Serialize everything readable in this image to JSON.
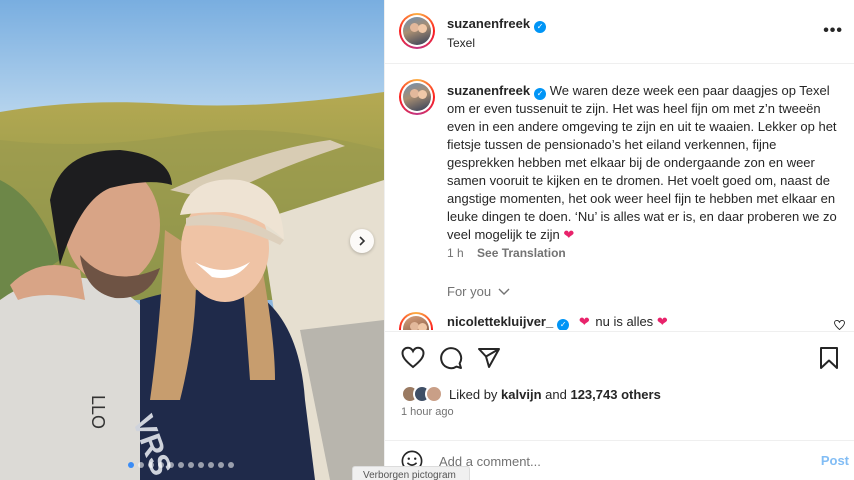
{
  "post": {
    "username": "suzanenfreek",
    "location": "Texel",
    "more_label": "•••",
    "caption": "We waren deze week een paar daagjes op Texel om er even tussenuit te zijn. Het was heel fijn om met z’n tweeën even in een andere omgeving te zijn en uit te waaien. Lekker op het fietsje tussen de pensionado’s het eiland verkennen, fijne gesprekken hebben met elkaar bij de ondergaande zon en weer samen vooruit te kijken en te dromen. Het voelt goed om, naast de angstige momenten, het ook weer heel fijn te hebben met elkaar en leuke dingen te doen. ‘Nu’ is alles wat er is, en daar proberen we zo veel mogelijk te zijn",
    "caption_emoji": "❤",
    "age": "1 h",
    "see_translation": "See Translation",
    "for_you": "For you"
  },
  "comment": {
    "username": "nicolettekluijver_",
    "emoji": "❤",
    "text": "nu is alles",
    "like_icon": "heart-outline-icon"
  },
  "likes": {
    "prefix": "Liked by",
    "user": "kalvijn",
    "and": "and",
    "count": "123,743 others"
  },
  "timestamp": "1 hour ago",
  "add_comment": {
    "placeholder": "Add a comment...",
    "post_label": "Post"
  },
  "tooltip": "Verborgen pictogram",
  "carousel": {
    "total_slides": 11,
    "active_index": 0
  },
  "colors": {
    "accent": "#0095f6",
    "heart": "#e8236b",
    "post_disabled": "#82bdf5"
  }
}
